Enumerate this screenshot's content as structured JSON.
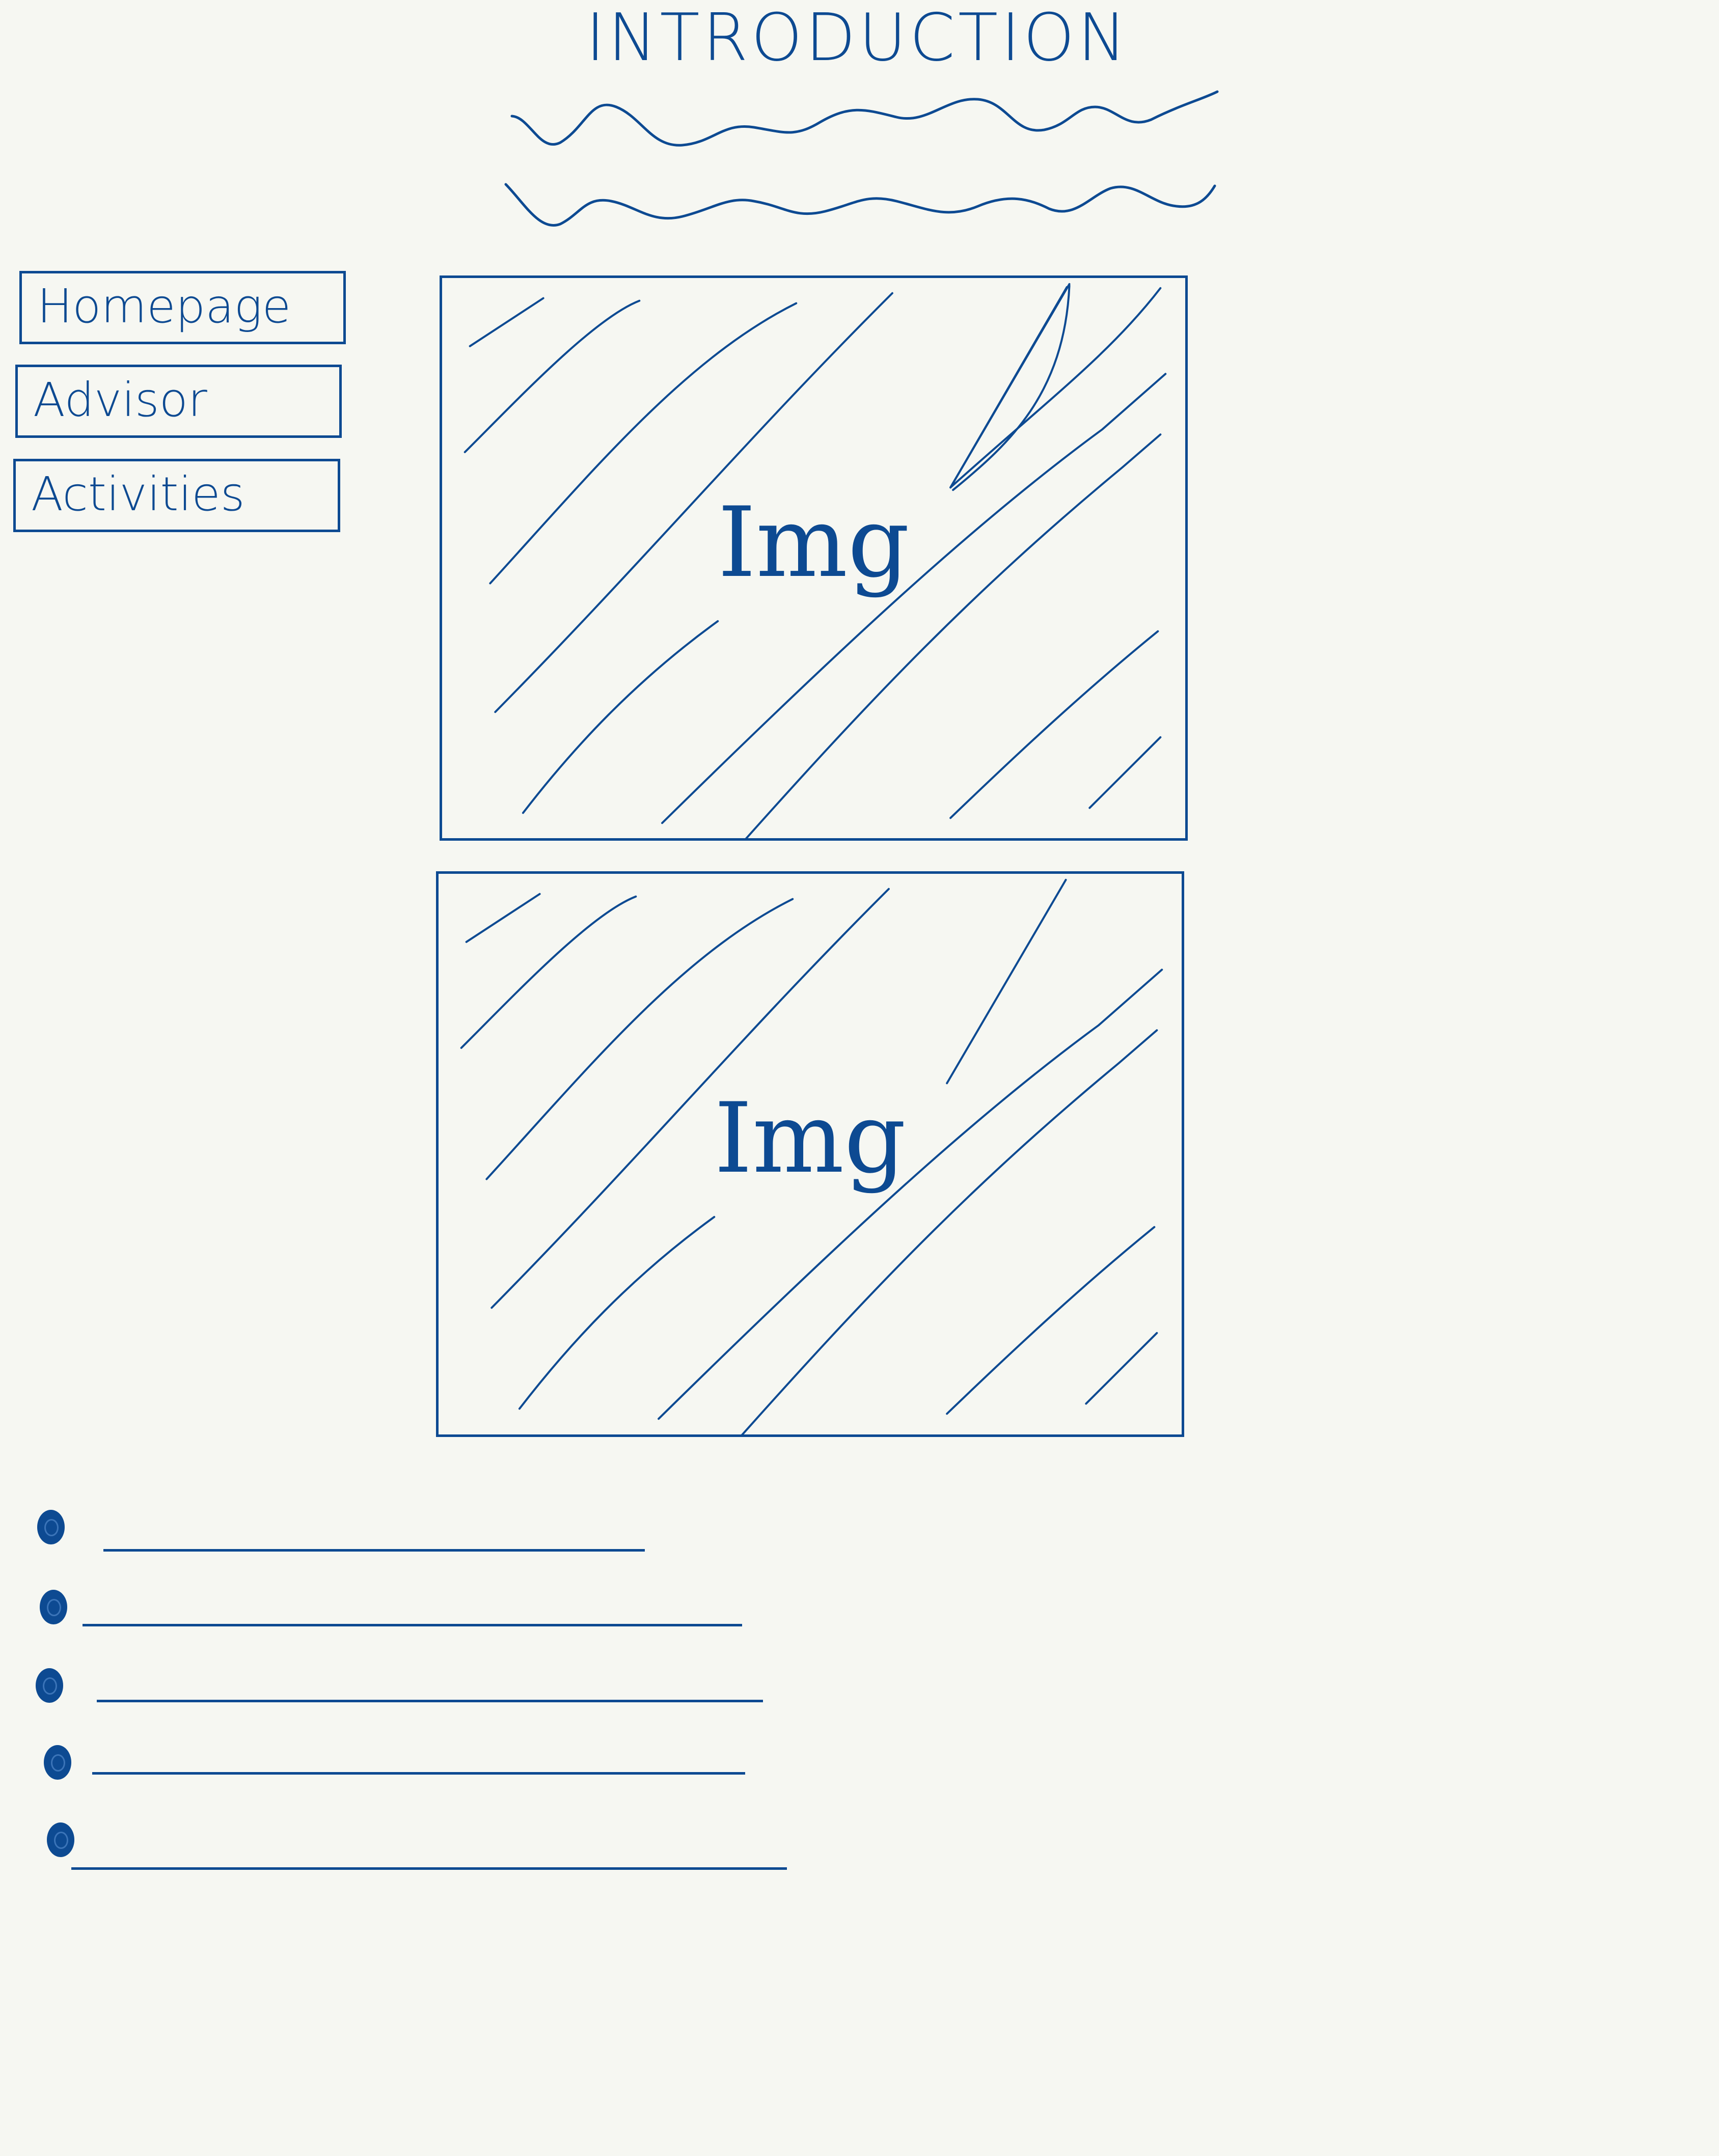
{
  "header": {
    "title": "INTRODUCTION"
  },
  "sidebar": {
    "items": [
      {
        "label": "Homepage"
      },
      {
        "label": "Advisor"
      },
      {
        "label": "Activities"
      }
    ]
  },
  "main": {
    "images": [
      {
        "label": "Img"
      },
      {
        "label": "Img"
      }
    ]
  },
  "colors": {
    "ink": "#0d4a92",
    "paper": "#f6f7f2"
  }
}
